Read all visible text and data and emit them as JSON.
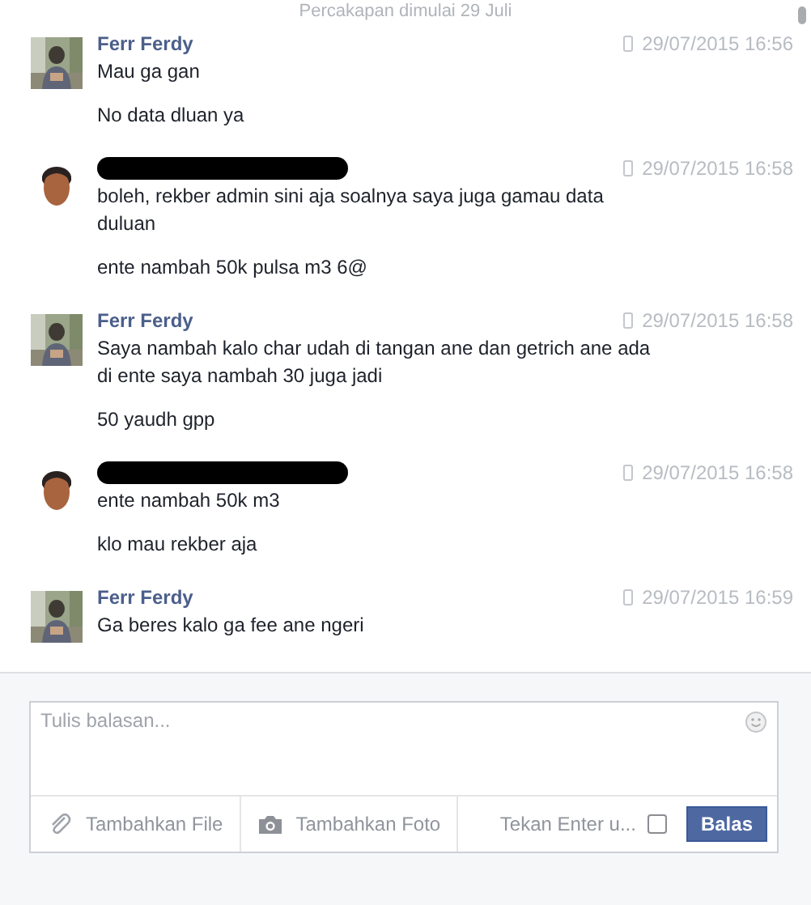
{
  "conversation_start": "Percakapan dimulai 29 Juli",
  "messages": [
    {
      "sender": "Ferr Ferdy",
      "redacted": false,
      "time": "29/07/2015 16:56",
      "lines": [
        "Mau ga gan",
        "No data dluan ya"
      ]
    },
    {
      "kind": "cartoon",
      "redacted": true,
      "time": "29/07/2015 16:58",
      "lines": [
        "boleh, rekber admin sini aja soalnya saya juga gamau data duluan",
        "ente nambah 50k pulsa m3 6@"
      ]
    },
    {
      "sender": "Ferr Ferdy",
      "redacted": false,
      "time": "29/07/2015 16:58",
      "lines": [
        "Saya nambah kalo char udah di tangan ane dan getrich ane ada di ente saya nambah 30 juga jadi",
        "50 yaudh gpp"
      ]
    },
    {
      "kind": "cartoon",
      "redacted": true,
      "time": "29/07/2015 16:58",
      "lines": [
        "ente nambah 50k m3",
        "klo mau rekber aja"
      ]
    },
    {
      "sender": "Ferr Ferdy",
      "redacted": false,
      "time": "29/07/2015 16:59",
      "lines": [
        "Ga beres kalo ga fee ane ngeri"
      ]
    }
  ],
  "composer": {
    "placeholder": "Tulis balasan...",
    "actions": [
      {
        "kind": "file",
        "label": "Tambahkan File"
      },
      {
        "label": "Tambahkan Foto"
      }
    ],
    "enter_to_send": {
      "label": "Tekan Enter u...",
      "checked": false
    },
    "send_button": "Balas"
  }
}
